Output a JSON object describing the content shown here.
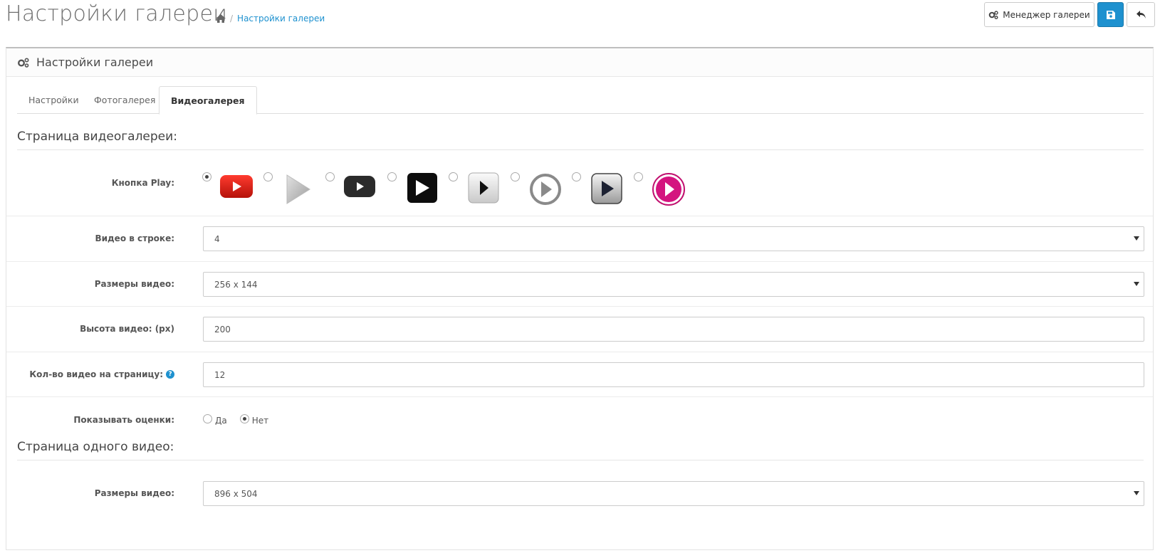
{
  "header": {
    "title": "Настройки галереи",
    "breadcrumb": [
      "Настройки галереи"
    ],
    "manager_button": "Менеджер галереи",
    "save_icon": "save-icon",
    "back_icon": "reply-icon"
  },
  "panel": {
    "heading": "Настройки галереи",
    "heading_icon": "cogs-icon"
  },
  "tabs": [
    {
      "label": "Настройки",
      "active": false
    },
    {
      "label": "Фотогалерея",
      "active": false
    },
    {
      "label": "Видеогалерея",
      "active": true
    }
  ],
  "video_page": {
    "section_title": "Страница видеогалереи:",
    "play_button": {
      "label": "Кнопка Play:",
      "selected_index": 0,
      "options": [
        "youtube-red",
        "gray-triangle",
        "youtube-dark",
        "black-square",
        "light-square",
        "gray-circle",
        "dark-gradient",
        "pink-circle"
      ]
    },
    "videos_per_row": {
      "label": "Видео в строке:",
      "value": "4"
    },
    "video_size": {
      "label": "Размеры видео:",
      "value": "256 x 144"
    },
    "video_height": {
      "label": "Высота видео: (px)",
      "value": "200"
    },
    "videos_per_page": {
      "label": "Кол-во видео на страницу:",
      "value": "12"
    },
    "show_ratings": {
      "label": "Показывать оценки:",
      "yes": "Да",
      "no": "Нет",
      "selected": "no"
    }
  },
  "single_video_page": {
    "section_title": "Страница одного видео:",
    "video_size": {
      "label": "Размеры видео:",
      "value": "896 x 504"
    }
  },
  "colors": {
    "accent": "#1e91cf",
    "youtube_red": "#e62117",
    "pink": "#d4147f"
  }
}
